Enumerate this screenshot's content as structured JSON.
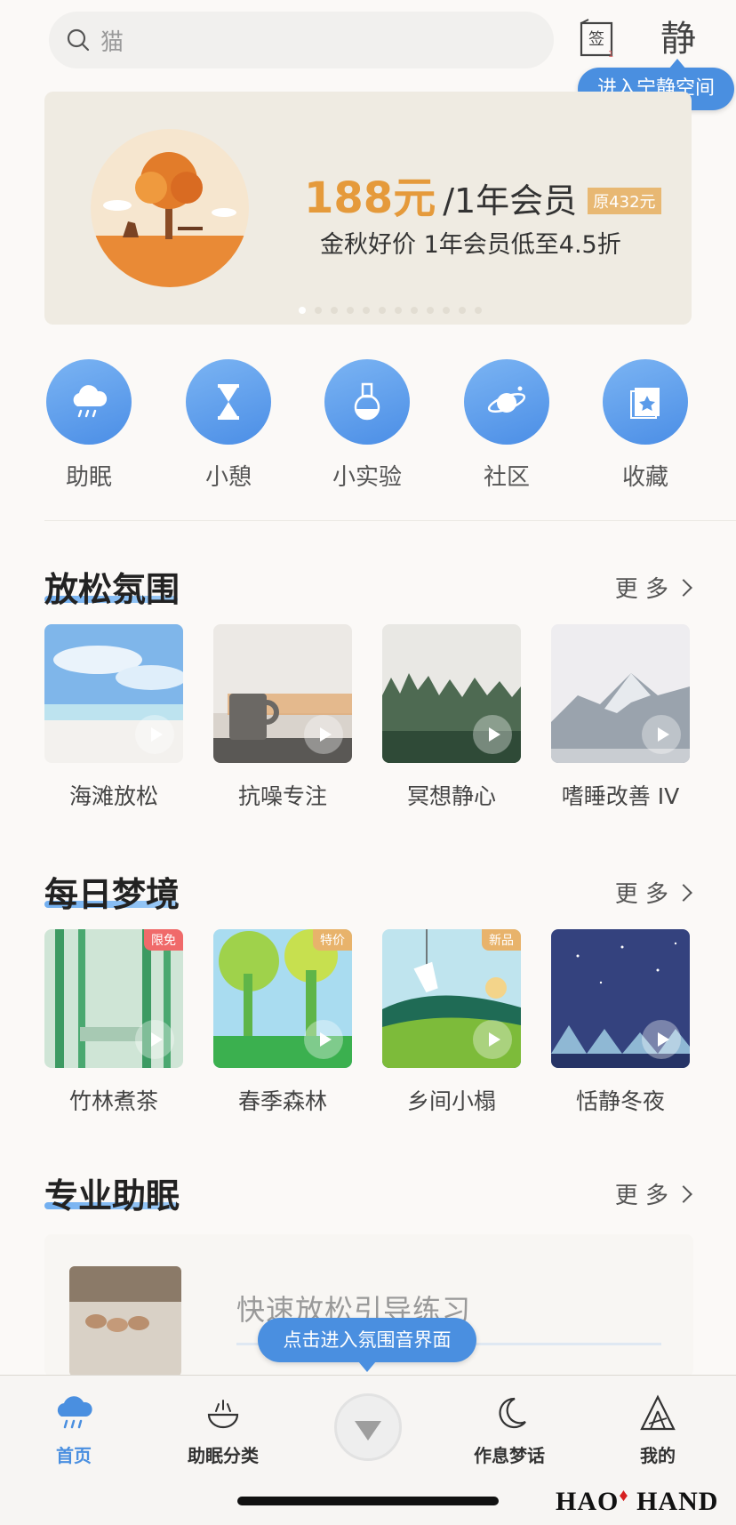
{
  "search": {
    "placeholder": "猫"
  },
  "header": {
    "quiet_button": "静",
    "quiet_tooltip": "进入宁静空间"
  },
  "banner": {
    "price": "188元",
    "period": "/1年会员",
    "original": "原432元",
    "subtitle": "金秋好价 1年会员低至4.5折",
    "active_dot": 0
  },
  "categories": [
    {
      "label": "助眠",
      "icon": "rain-cloud-icon"
    },
    {
      "label": "小憩",
      "icon": "hourglass-icon"
    },
    {
      "label": "小实验",
      "icon": "flask-icon"
    },
    {
      "label": "社区",
      "icon": "planet-icon"
    },
    {
      "label": "收藏",
      "icon": "star-book-icon"
    }
  ],
  "sections": {
    "relax": {
      "title": "放松氛围",
      "more": "更 多",
      "items": [
        {
          "name": "海滩放松"
        },
        {
          "name": "抗噪专注"
        },
        {
          "name": "冥想静心"
        },
        {
          "name": "嗜睡改善 IV"
        }
      ]
    },
    "dream": {
      "title": "每日梦境",
      "more": "更 多",
      "items": [
        {
          "name": "竹林煮茶",
          "badge": "限免",
          "badge_color": "#f06a6a"
        },
        {
          "name": "春季森林",
          "badge": "特价",
          "badge_color": "#e8b36b"
        },
        {
          "name": "乡间小榻",
          "badge": "新品",
          "badge_color": "#e8b36b"
        },
        {
          "name": "恬静冬夜"
        }
      ]
    },
    "pro": {
      "title": "专业助眠",
      "more": "更 多",
      "item_title": "快速放松引导练习"
    }
  },
  "bottom_tooltip": "点击进入氛围音界面",
  "tabs": [
    {
      "label": "首页",
      "active": true
    },
    {
      "label": "助眠分类"
    },
    {
      "label": "作息梦话"
    },
    {
      "label": "我的"
    }
  ],
  "watermark": {
    "left": "HAO",
    "right": "HAND"
  },
  "colors": {
    "accent": "#4a8fe0",
    "price": "#e59a3b"
  }
}
